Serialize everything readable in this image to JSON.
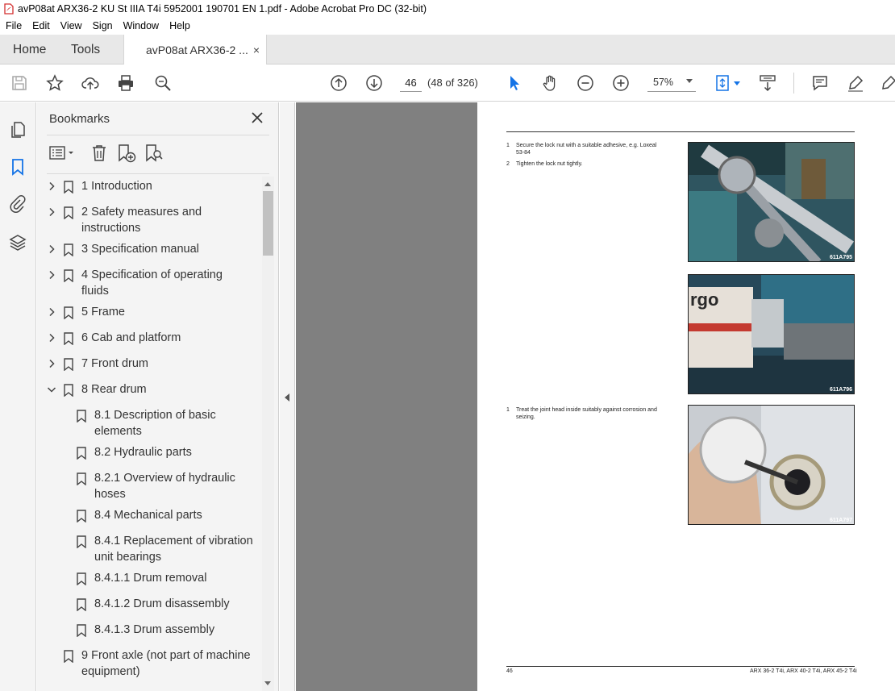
{
  "window": {
    "title": "avP08at ARX36-2 KU St IIIA T4i 5952001 190701 EN 1.pdf - Adobe Acrobat Pro DC (32-bit)"
  },
  "menu": [
    "File",
    "Edit",
    "View",
    "Sign",
    "Window",
    "Help"
  ],
  "tabs": {
    "home": "Home",
    "tools": "Tools",
    "document": "avP08at ARX36-2 ...",
    "close": "×"
  },
  "toolbar": {
    "page_current": "46",
    "page_count": "(48 of 326)",
    "zoom": "57%"
  },
  "bookmarks": {
    "header": "Bookmarks",
    "items": [
      {
        "lines": [
          "1 Introduction"
        ],
        "level": 0,
        "expandable": true
      },
      {
        "lines": [
          "2 Safety measures and",
          "instructions"
        ],
        "level": 0,
        "expandable": true
      },
      {
        "lines": [
          "3 Specification manual"
        ],
        "level": 0,
        "expandable": true
      },
      {
        "lines": [
          "4 Specification of operating",
          "fluids"
        ],
        "level": 0,
        "expandable": true
      },
      {
        "lines": [
          "5 Frame"
        ],
        "level": 0,
        "expandable": true
      },
      {
        "lines": [
          "6 Cab and platform"
        ],
        "level": 0,
        "expandable": true
      },
      {
        "lines": [
          "7 Front drum"
        ],
        "level": 0,
        "expandable": true
      },
      {
        "lines": [
          "8 Rear drum"
        ],
        "level": 0,
        "expandable": true,
        "expanded": true
      },
      {
        "lines": [
          "8.1 Description of basic",
          "elements"
        ],
        "level": 1
      },
      {
        "lines": [
          "8.2 Hydraulic parts"
        ],
        "level": 1
      },
      {
        "lines": [
          "8.2.1 Overview of hydraulic",
          "hoses"
        ],
        "level": 1
      },
      {
        "lines": [
          "8.4 Mechanical parts"
        ],
        "level": 1
      },
      {
        "lines": [
          "8.4.1 Replacement of vibration",
          "unit bearings"
        ],
        "level": 1
      },
      {
        "lines": [
          "8.4.1.1 Drum removal"
        ],
        "level": 1
      },
      {
        "lines": [
          "8.4.1.2 Drum disassembly"
        ],
        "level": 1
      },
      {
        "lines": [
          "8.4.1.3 Drum assembly"
        ],
        "level": 1
      },
      {
        "lines": [
          "9 Front axle (not part of machine",
          "equipment)"
        ],
        "level": 0
      }
    ]
  },
  "document": {
    "steps_a": [
      {
        "num": "1",
        "text": "Secure the lock nut with a suitable adhesive, e.g. Loxeal",
        "text2": "53-84"
      },
      {
        "num": "2",
        "text": "Tighten the lock nut tightly.",
        "text2": ""
      }
    ],
    "steps_b": [
      {
        "num": "1",
        "text": "Treat the joint head inside suitably against corrosion and",
        "text2": "seizing."
      }
    ],
    "photos": [
      "611A795",
      "611A796",
      "611A797"
    ],
    "photo2_text": "rgo",
    "footer_page": "46",
    "footer_models": "ARX 36-2 T4i, ARX 40-2 T4i, ARX 45-2 T4i"
  }
}
